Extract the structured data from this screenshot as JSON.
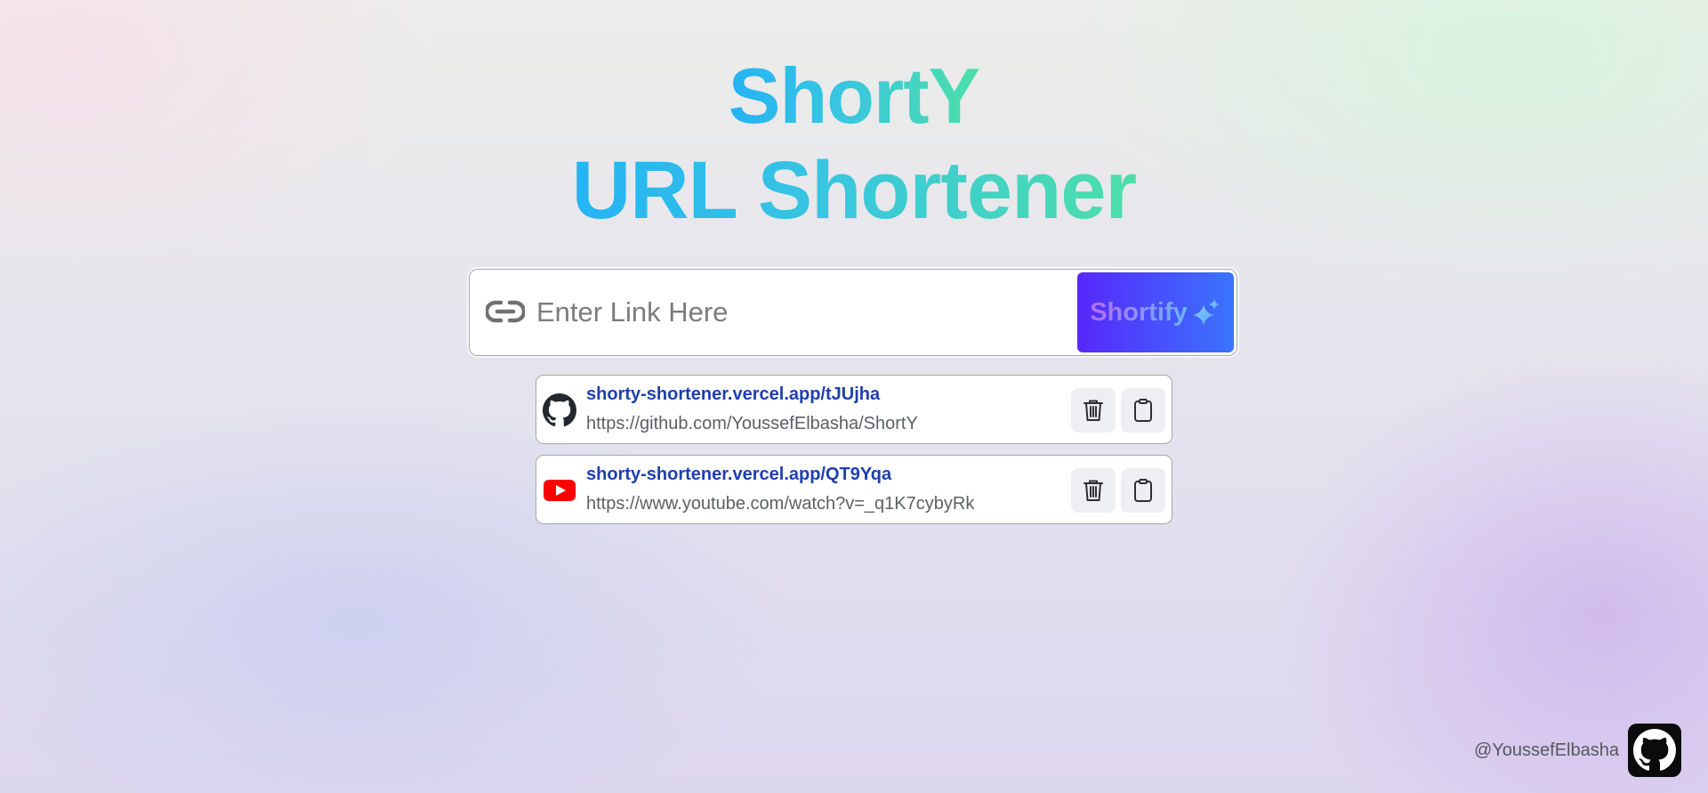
{
  "header": {
    "title_line1": "ShortY",
    "title_line2": "URL Shortener"
  },
  "form": {
    "input_placeholder": "Enter Link Here",
    "input_value": "",
    "submit_label": "Shortify",
    "link_icon": "link-icon",
    "submit_icon": "sparkles-icon"
  },
  "links": [
    {
      "short_url": "shorty-shortener.vercel.app/tJUjha",
      "original_url": "https://github.com/YoussefElbasha/ShortY",
      "site_icon": "github-icon",
      "delete_icon": "trash-icon",
      "copy_icon": "clipboard-icon"
    },
    {
      "short_url": "shorty-shortener.vercel.app/QT9Yqa",
      "original_url": "https://www.youtube.com/watch?v=_q1K7cybyRk",
      "site_icon": "youtube-icon",
      "delete_icon": "trash-icon",
      "copy_icon": "clipboard-icon"
    }
  ],
  "footer": {
    "handle": "@YoussefElbasha",
    "icon": "github-icon"
  },
  "colors": {
    "title_gradient_start": "#24b3f5",
    "title_gradient_end": "#4ddfa8",
    "button_gradient_start": "#5728fb",
    "button_gradient_end": "#3a74fc",
    "short_link": "#1e3fae",
    "youtube_red": "#ff0000"
  }
}
